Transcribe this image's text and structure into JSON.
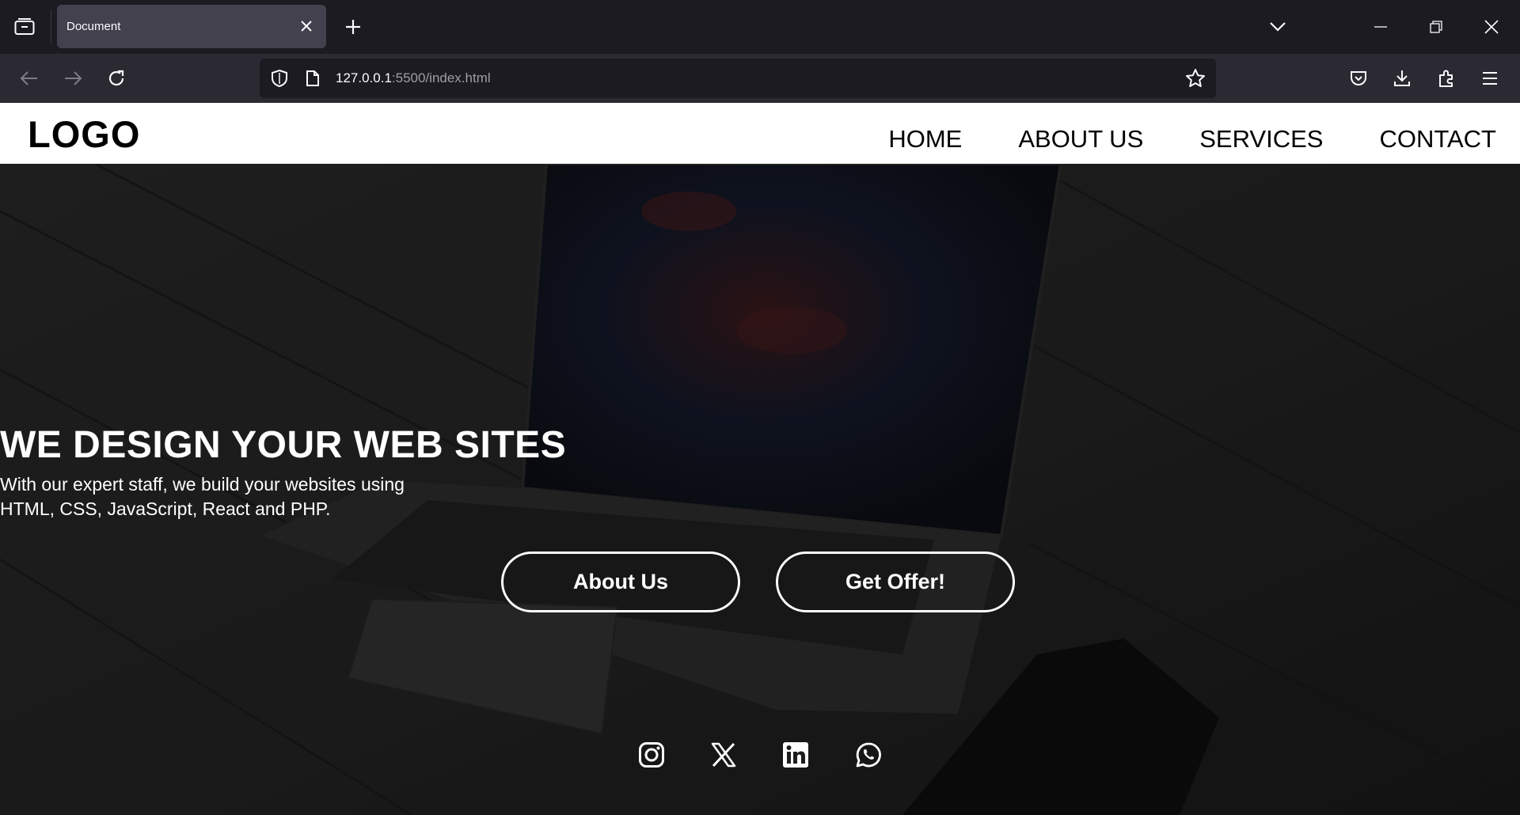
{
  "browser": {
    "tab": {
      "title": "Document"
    },
    "url": {
      "host": "127.0.0.1",
      "path": ":5500/index.html"
    },
    "icons": {
      "tab_list": "tab-list-icon",
      "close_tab": "close-icon",
      "new_tab": "plus-icon",
      "list_all_tabs": "chevron-down-icon",
      "minimize": "minimize-icon",
      "restore": "restore-icon",
      "close_window": "close-icon",
      "back": "back-arrow-icon",
      "forward": "forward-arrow-icon",
      "reload": "reload-icon",
      "shield": "shield-icon",
      "page": "page-icon",
      "bookmark": "star-icon",
      "pocket": "pocket-icon",
      "downloads": "download-icon",
      "extensions": "puzzle-icon",
      "menu": "hamburger-icon"
    }
  },
  "site": {
    "logo": "LOGO",
    "nav": [
      "HOME",
      "ABOUT US",
      "SERVICES",
      "CONTACT"
    ],
    "hero": {
      "title": "WE DESIGN YOUR WEB SITES",
      "subtitle_line1": "With our expert staff, we build your websites using",
      "subtitle_line2": "HTML, CSS, JavaScript, React and PHP.",
      "buttons": [
        "About Us",
        "Get Offer!"
      ]
    },
    "social": [
      "instagram-icon",
      "x-icon",
      "linkedin-icon",
      "whatsapp-icon"
    ]
  },
  "colors": {
    "chrome_bg": "#1c1b22",
    "toolbar_bg": "#2b2a33",
    "tab_active": "#42414d",
    "header_bg": "#ffffff",
    "hero_overlay": "#1d1d1d",
    "text_light": "#ffffff"
  }
}
